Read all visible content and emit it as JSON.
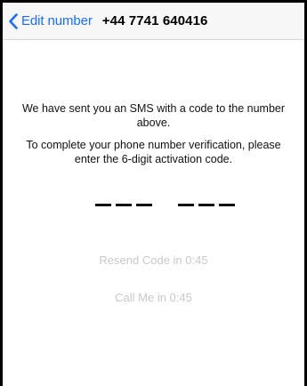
{
  "navbar": {
    "back_label": "Edit number",
    "phone_number": "+44 7741 640416",
    "accent_color": "#1a6dff",
    "back_icon": "chevron-left-icon"
  },
  "main": {
    "message_sent": "We have sent you an SMS with a code to the number above.",
    "message_instruction": "To complete your phone number verification, please enter the 6-digit activation code.",
    "code_length": 6,
    "resend_label": "Resend Code in 0:45",
    "call_me_label": "Call Me in 0:45",
    "disabled_color": "#c9c9cc"
  }
}
